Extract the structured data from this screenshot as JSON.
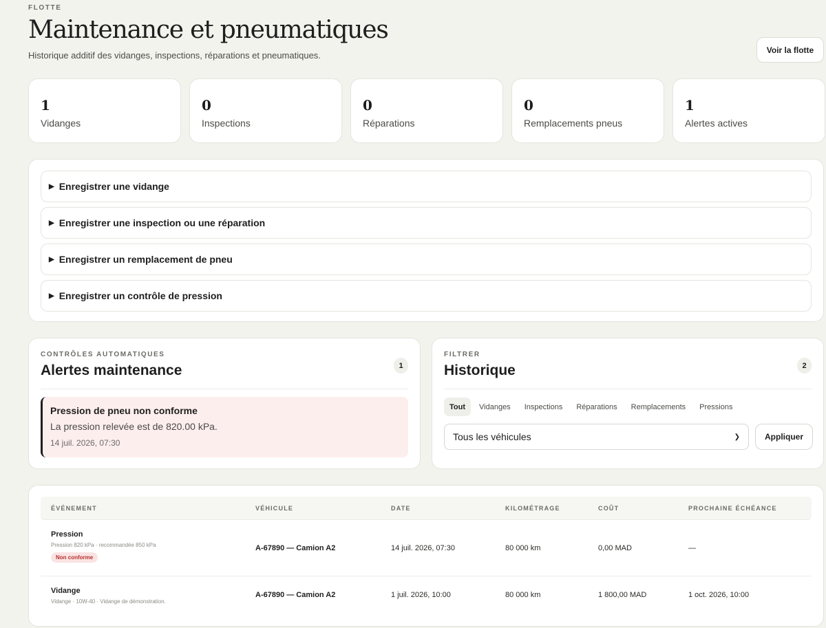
{
  "header": {
    "eyebrow": "FLOTTE",
    "title": "Maintenance et pneumatiques",
    "subtitle": "Historique additif des vidanges, inspections, réparations et pneumatiques.",
    "fleet_button": "Voir la flotte"
  },
  "stats": [
    {
      "value": "1",
      "label": "Vidanges"
    },
    {
      "value": "0",
      "label": "Inspections"
    },
    {
      "value": "0",
      "label": "Réparations"
    },
    {
      "value": "0",
      "label": "Remplacements pneus"
    },
    {
      "value": "1",
      "label": "Alertes actives"
    }
  ],
  "forms": [
    {
      "label": "Enregistrer une vidange"
    },
    {
      "label": "Enregistrer une inspection ou une réparation"
    },
    {
      "label": "Enregistrer un remplacement de pneu"
    },
    {
      "label": "Enregistrer un contrôle de pression"
    }
  ],
  "alerts_panel": {
    "eyebrow": "CONTRÔLES AUTOMATIQUES",
    "title": "Alertes maintenance",
    "count": "1",
    "alert": {
      "title": "Pression de pneu non conforme",
      "body": "La pression relevée est de 820.00 kPa.",
      "time": "14 juil. 2026, 07:30"
    }
  },
  "history_panel": {
    "eyebrow": "FILTRER",
    "title": "Historique",
    "count": "2",
    "tabs": [
      "Tout",
      "Vidanges",
      "Inspections",
      "Réparations",
      "Remplacements",
      "Pressions"
    ],
    "active_tab": "Tout",
    "vehicle_select": "Tous les véhicules",
    "apply_button": "Appliquer"
  },
  "table": {
    "headers": [
      "ÉVÉNEMENT",
      "VÉHICULE",
      "DATE",
      "KILOMÉTRAGE",
      "COÛT",
      "PROCHAINE ÉCHÉANCE"
    ],
    "rows": [
      {
        "event": "Pression",
        "detail": "Pression 820 kPa · recommandée 850 kPa",
        "badge": "Non conforme",
        "vehicle": "A-67890 — Camion A2",
        "date": "14 juil. 2026, 07:30",
        "mileage": "80 000 km",
        "cost": "0,00 MAD",
        "next_due": "—"
      },
      {
        "event": "Vidange",
        "detail": "Vidange · 10W-40 · Vidange de démonstration.",
        "vehicle": "A-67890 — Camion A2",
        "date": "1 juil. 2026, 10:00",
        "mileage": "80 000 km",
        "cost": "1 800,00 MAD",
        "next_due": "1 oct. 2026, 10:00"
      }
    ]
  }
}
